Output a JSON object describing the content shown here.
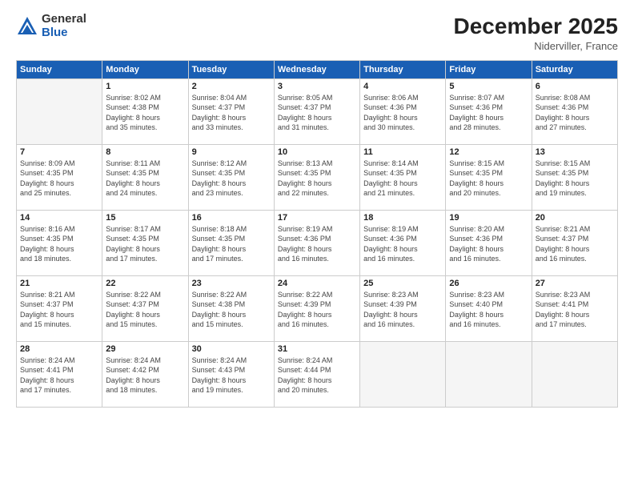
{
  "header": {
    "logo_general": "General",
    "logo_blue": "Blue",
    "title": "December 2025",
    "subtitle": "Niderviller, France"
  },
  "weekdays": [
    "Sunday",
    "Monday",
    "Tuesday",
    "Wednesday",
    "Thursday",
    "Friday",
    "Saturday"
  ],
  "weeks": [
    [
      {
        "day": "",
        "info": ""
      },
      {
        "day": "1",
        "info": "Sunrise: 8:02 AM\nSunset: 4:38 PM\nDaylight: 8 hours\nand 35 minutes."
      },
      {
        "day": "2",
        "info": "Sunrise: 8:04 AM\nSunset: 4:37 PM\nDaylight: 8 hours\nand 33 minutes."
      },
      {
        "day": "3",
        "info": "Sunrise: 8:05 AM\nSunset: 4:37 PM\nDaylight: 8 hours\nand 31 minutes."
      },
      {
        "day": "4",
        "info": "Sunrise: 8:06 AM\nSunset: 4:36 PM\nDaylight: 8 hours\nand 30 minutes."
      },
      {
        "day": "5",
        "info": "Sunrise: 8:07 AM\nSunset: 4:36 PM\nDaylight: 8 hours\nand 28 minutes."
      },
      {
        "day": "6",
        "info": "Sunrise: 8:08 AM\nSunset: 4:36 PM\nDaylight: 8 hours\nand 27 minutes."
      }
    ],
    [
      {
        "day": "7",
        "info": "Sunrise: 8:09 AM\nSunset: 4:35 PM\nDaylight: 8 hours\nand 25 minutes."
      },
      {
        "day": "8",
        "info": "Sunrise: 8:11 AM\nSunset: 4:35 PM\nDaylight: 8 hours\nand 24 minutes."
      },
      {
        "day": "9",
        "info": "Sunrise: 8:12 AM\nSunset: 4:35 PM\nDaylight: 8 hours\nand 23 minutes."
      },
      {
        "day": "10",
        "info": "Sunrise: 8:13 AM\nSunset: 4:35 PM\nDaylight: 8 hours\nand 22 minutes."
      },
      {
        "day": "11",
        "info": "Sunrise: 8:14 AM\nSunset: 4:35 PM\nDaylight: 8 hours\nand 21 minutes."
      },
      {
        "day": "12",
        "info": "Sunrise: 8:15 AM\nSunset: 4:35 PM\nDaylight: 8 hours\nand 20 minutes."
      },
      {
        "day": "13",
        "info": "Sunrise: 8:15 AM\nSunset: 4:35 PM\nDaylight: 8 hours\nand 19 minutes."
      }
    ],
    [
      {
        "day": "14",
        "info": "Sunrise: 8:16 AM\nSunset: 4:35 PM\nDaylight: 8 hours\nand 18 minutes."
      },
      {
        "day": "15",
        "info": "Sunrise: 8:17 AM\nSunset: 4:35 PM\nDaylight: 8 hours\nand 17 minutes."
      },
      {
        "day": "16",
        "info": "Sunrise: 8:18 AM\nSunset: 4:35 PM\nDaylight: 8 hours\nand 17 minutes."
      },
      {
        "day": "17",
        "info": "Sunrise: 8:19 AM\nSunset: 4:36 PM\nDaylight: 8 hours\nand 16 minutes."
      },
      {
        "day": "18",
        "info": "Sunrise: 8:19 AM\nSunset: 4:36 PM\nDaylight: 8 hours\nand 16 minutes."
      },
      {
        "day": "19",
        "info": "Sunrise: 8:20 AM\nSunset: 4:36 PM\nDaylight: 8 hours\nand 16 minutes."
      },
      {
        "day": "20",
        "info": "Sunrise: 8:21 AM\nSunset: 4:37 PM\nDaylight: 8 hours\nand 16 minutes."
      }
    ],
    [
      {
        "day": "21",
        "info": "Sunrise: 8:21 AM\nSunset: 4:37 PM\nDaylight: 8 hours\nand 15 minutes."
      },
      {
        "day": "22",
        "info": "Sunrise: 8:22 AM\nSunset: 4:37 PM\nDaylight: 8 hours\nand 15 minutes."
      },
      {
        "day": "23",
        "info": "Sunrise: 8:22 AM\nSunset: 4:38 PM\nDaylight: 8 hours\nand 15 minutes."
      },
      {
        "day": "24",
        "info": "Sunrise: 8:22 AM\nSunset: 4:39 PM\nDaylight: 8 hours\nand 16 minutes."
      },
      {
        "day": "25",
        "info": "Sunrise: 8:23 AM\nSunset: 4:39 PM\nDaylight: 8 hours\nand 16 minutes."
      },
      {
        "day": "26",
        "info": "Sunrise: 8:23 AM\nSunset: 4:40 PM\nDaylight: 8 hours\nand 16 minutes."
      },
      {
        "day": "27",
        "info": "Sunrise: 8:23 AM\nSunset: 4:41 PM\nDaylight: 8 hours\nand 17 minutes."
      }
    ],
    [
      {
        "day": "28",
        "info": "Sunrise: 8:24 AM\nSunset: 4:41 PM\nDaylight: 8 hours\nand 17 minutes."
      },
      {
        "day": "29",
        "info": "Sunrise: 8:24 AM\nSunset: 4:42 PM\nDaylight: 8 hours\nand 18 minutes."
      },
      {
        "day": "30",
        "info": "Sunrise: 8:24 AM\nSunset: 4:43 PM\nDaylight: 8 hours\nand 19 minutes."
      },
      {
        "day": "31",
        "info": "Sunrise: 8:24 AM\nSunset: 4:44 PM\nDaylight: 8 hours\nand 20 minutes."
      },
      {
        "day": "",
        "info": ""
      },
      {
        "day": "",
        "info": ""
      },
      {
        "day": "",
        "info": ""
      }
    ]
  ]
}
